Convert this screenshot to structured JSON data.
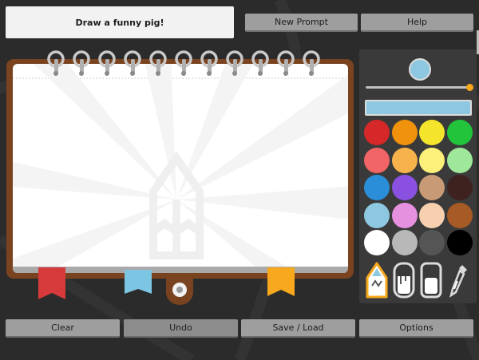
{
  "prompt": {
    "text": "Draw a funny pig!"
  },
  "header": {
    "new_prompt_label": "New Prompt",
    "help_label": "Help"
  },
  "footer": {
    "clear_label": "Clear",
    "undo_label": "Undo",
    "save_load_label": "Save / Load",
    "options_label": "Options"
  },
  "tools": {
    "selected_color": "#8ec8e0",
    "brush_size": 1.0,
    "palette": [
      "#d62828",
      "#f0920c",
      "#f5e42c",
      "#22c43c",
      "#f26566",
      "#f8b24c",
      "#fdf07a",
      "#9fe79a",
      "#2a8fd8",
      "#8a50e0",
      "#c89a76",
      "#3d2220",
      "#8ec8e0",
      "#e690e0",
      "#f7d0b0",
      "#a65a25",
      "#ffffff",
      "#b8b8b8",
      "#555555",
      "#000000"
    ],
    "items": [
      {
        "icon": "pencil-icon",
        "selected": true
      },
      {
        "icon": "paint-bucket-icon",
        "selected": false
      },
      {
        "icon": "eraser-icon",
        "selected": false
      },
      {
        "icon": "eyedropper-icon",
        "selected": false
      }
    ]
  },
  "notebook": {
    "tabs": [
      {
        "color": "#d63a3a"
      },
      {
        "color": "#7cc5e3"
      },
      {
        "color": "#f7a81c"
      }
    ]
  }
}
